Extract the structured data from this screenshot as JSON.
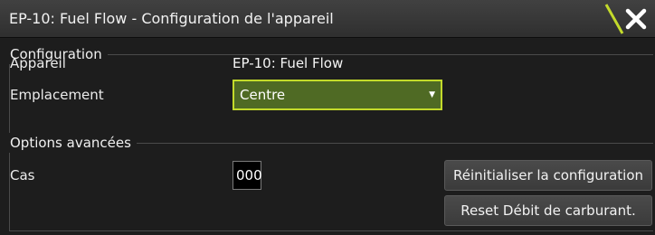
{
  "window": {
    "title": "EP-10: Fuel Flow - Configuration de l'appareil",
    "close_icon": "close-icon"
  },
  "configuration": {
    "legend": "Configuration",
    "device_label": "Appareil",
    "device_value": "EP-10: Fuel Flow",
    "location_label": "Emplacement",
    "location_value": "Centre"
  },
  "advanced": {
    "legend": "Options avancées",
    "instance_label": "Cas",
    "instance_value": "000",
    "reset_config_button": "Réinitialiser la configuration",
    "reset_fuel_button": "Reset Débit de carburant."
  },
  "colors": {
    "accent": "#c3da2b",
    "select_fill": "#4f6a24",
    "background": "#1d1d1d"
  }
}
